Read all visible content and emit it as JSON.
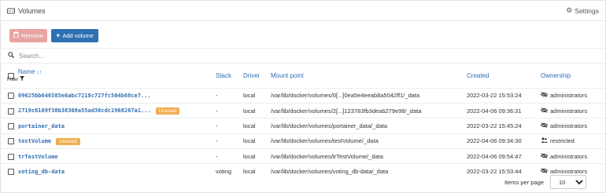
{
  "header": {
    "title": "Volumes",
    "settings_label": "Settings"
  },
  "toolbar": {
    "remove_label": "Remove",
    "add_label": "Add volume"
  },
  "search": {
    "placeholder": "Search..."
  },
  "columns": {
    "name": "Name",
    "filter": "Filter",
    "stack": "Stack",
    "driver": "Driver",
    "mount": "Mount point",
    "created": "Created",
    "ownership": "Ownership"
  },
  "rows": [
    {
      "name": "09625bb646585e6abc7218c727fc504b68ce7...",
      "badge": "",
      "stack": "-",
      "driver": "local",
      "mount": "/var/lib/docker/volumes/0[...]0ea5e4eeab8a5042ff1/_data",
      "created": "2022-03-22 15:53:24",
      "ownership": "administrators",
      "ownership_icon": "eye-slash-icon"
    },
    {
      "name": "2719c6109f38b38308a55ad30cdc1968267a1...",
      "badge": "Unused",
      "stack": "-",
      "driver": "local",
      "mount": "/var/lib/docker/volumes/2[...]123783fb3deab279e98/_data",
      "created": "2022-04-06 09:36:31",
      "ownership": "administrators",
      "ownership_icon": "eye-slash-icon"
    },
    {
      "name": "portainer_data",
      "badge": "",
      "stack": "-",
      "driver": "local",
      "mount": "/var/lib/docker/volumes/portainer_data/_data",
      "created": "2022-03-22 15:45:24",
      "ownership": "administrators",
      "ownership_icon": "eye-slash-icon"
    },
    {
      "name": "testVolume",
      "badge": "Unused",
      "stack": "-",
      "driver": "local",
      "mount": "/var/lib/docker/volumes/testVolume/_data",
      "created": "2022-04-06 09:34:30",
      "ownership": "restricted",
      "ownership_icon": "users-icon"
    },
    {
      "name": "trTestVolume",
      "badge": "",
      "stack": "-",
      "driver": "local",
      "mount": "/var/lib/docker/volumes/trTestVolume/_data",
      "created": "2022-04-06 09:54:47",
      "ownership": "administrators",
      "ownership_icon": "eye-slash-icon"
    },
    {
      "name": "voting_db-data",
      "badge": "",
      "stack": "voting",
      "driver": "local",
      "mount": "/var/lib/docker/volumes/voting_db-data/_data",
      "created": "2022-03-22 15:53:44",
      "ownership": "administrators",
      "ownership_icon": "eye-slash-icon"
    }
  ],
  "footer": {
    "items_per_page_label": "Items per page",
    "items_per_page_value": "10"
  },
  "colors": {
    "link": "#2f6fb3",
    "remove_btn": "#e8a3a3",
    "add_btn": "#2f6fb3",
    "badge": "#f0ad4e"
  }
}
